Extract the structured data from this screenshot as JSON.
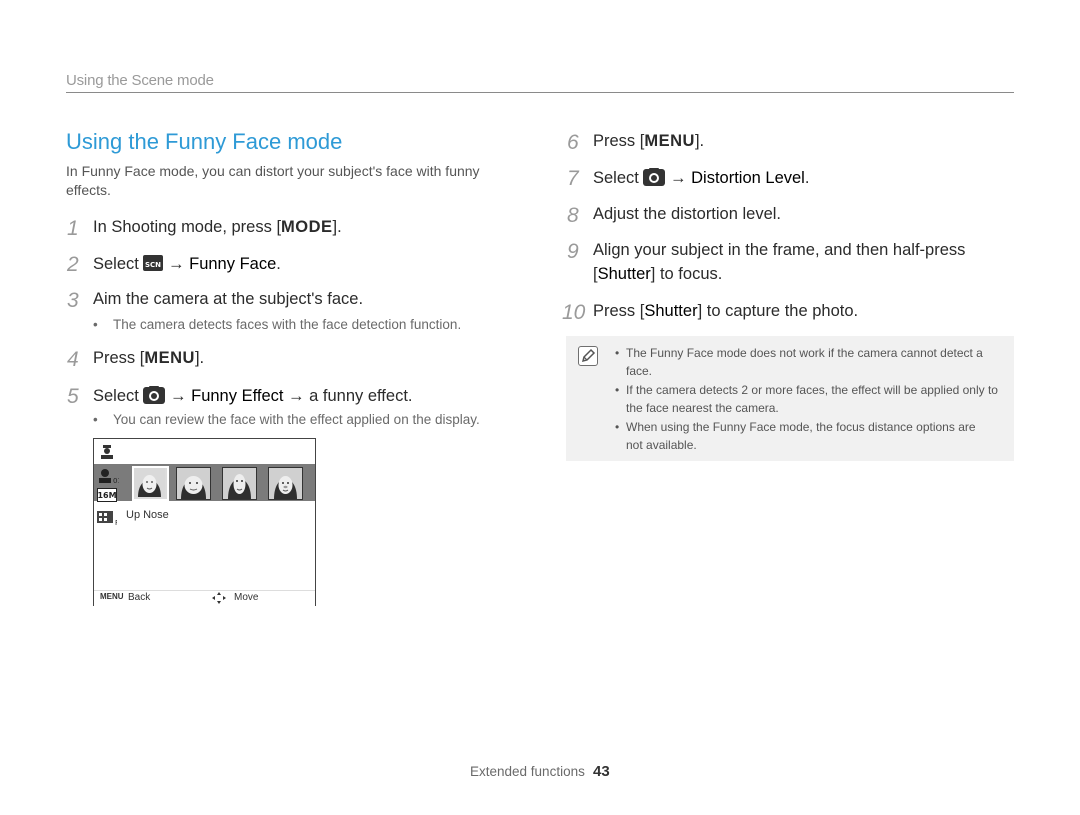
{
  "header": {
    "section": "Using the Scene mode"
  },
  "title": "Using the Funny Face mode",
  "intro": "In Funny Face mode, you can distort your subject's face with funny effects.",
  "steps_left": [
    {
      "num": "1",
      "pre": "In Shooting mode, press [",
      "key": "MODE",
      "post": "]."
    },
    {
      "num": "2",
      "pre": "Select ",
      "icon": "scene-icon",
      "arrow": " → ",
      "strong": "Funny Face",
      "post": "."
    },
    {
      "num": "3",
      "text": "Aim the camera at the subject's face.",
      "bullet": "The camera detects faces with the face detection function."
    },
    {
      "num": "4",
      "pre": "Press [",
      "key": "MENU",
      "post": "]."
    },
    {
      "num": "5",
      "pre": "Select ",
      "icon": "camera-icon",
      "arrow1": " → ",
      "strong": "Funny Effect",
      "arrow2": " → ",
      "post": "a funny effect.",
      "bullet": "You can review the face with the effect applied on the display."
    }
  ],
  "screen": {
    "option_label": "Up Nose",
    "back_key": "MENU",
    "back_label": "Back",
    "move_label": "Move"
  },
  "steps_right": [
    {
      "num": "6",
      "pre": "Press [",
      "key": "MENU",
      "post": "]."
    },
    {
      "num": "7",
      "pre": "Select ",
      "icon": "camera-icon",
      "arrow": " → ",
      "strong": "Distortion Level",
      "post": "."
    },
    {
      "num": "8",
      "text": "Adjust the distortion level."
    },
    {
      "num": "9",
      "line1": "Align your subject in the frame, and then half-press",
      "line2_pre": "[",
      "line2_strong": "Shutter",
      "line2_post": "] to focus."
    },
    {
      "num": "10",
      "pre": "Press [",
      "strong": "Shutter",
      "post": "] to capture the photo."
    }
  ],
  "notes": [
    "The Funny Face mode does not work if the camera cannot detect a face.",
    "If the camera detects 2 or more faces, the effect will be applied only to the face nearest the camera.",
    "When using the Funny Face mode, the focus distance options are not available."
  ],
  "footer": {
    "label": "Extended functions",
    "page": "43"
  },
  "colors": {
    "title": "#2e9ad6",
    "step_number": "#9a9a9a",
    "note_bg": "#f1f1f1"
  }
}
